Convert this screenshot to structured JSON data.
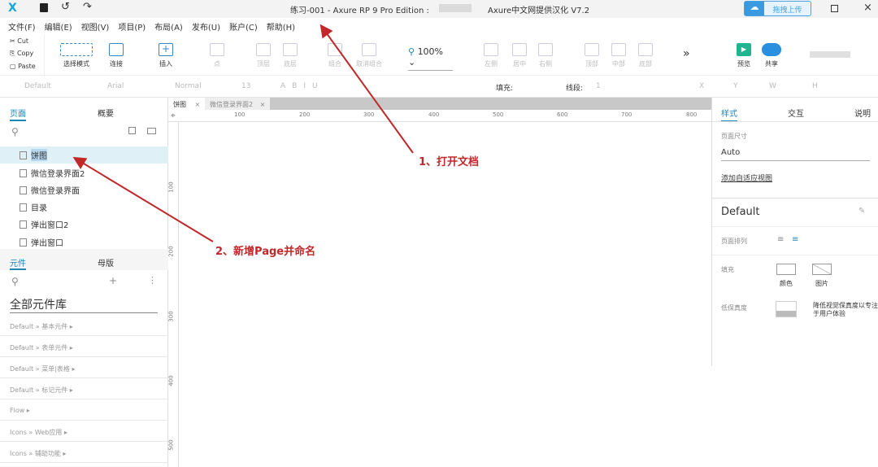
{
  "titlebar": {
    "title": "练习-001 - Axure RP 9 Pro Edition :",
    "subtitle": "Axure中文网提供汉化 V7.2",
    "upload": "拖拽上传"
  },
  "menu": [
    "文件(F)",
    "编辑(E)",
    "视图(V)",
    "项目(P)",
    "布局(A)",
    "发布(U)",
    "账户(C)",
    "帮助(H)"
  ],
  "clipboard": {
    "cut": "Cut",
    "copy": "Copy",
    "paste": "Paste"
  },
  "toolbar": {
    "select_mode": "选择模式",
    "connect": "连接",
    "insert": "插入",
    "point": "点",
    "top_layer": "顶层",
    "bottom_layer": "底层",
    "group": "组合",
    "ungroup": "取消组合",
    "zoom": "100%",
    "left": "左侧",
    "center": "居中",
    "right": "右侧",
    "top": "顶部",
    "middle": "中部",
    "bottom": "底部",
    "more": "»",
    "preview": "预览",
    "share": "共享"
  },
  "format": {
    "style": "Default",
    "font": "Arial",
    "weight": "Normal",
    "size": "13",
    "fill": "填充:",
    "line": "线段:",
    "line_w": "1",
    "x": "X",
    "y": "Y",
    "w": "W",
    "h": "H"
  },
  "doc_tabs": [
    "饼图",
    "微信登录界面2"
  ],
  "ruler": {
    "h": [
      "100",
      "200",
      "300",
      "400",
      "500",
      "600",
      "700",
      "800"
    ],
    "v": [
      "100",
      "200",
      "300",
      "400",
      "500"
    ]
  },
  "left": {
    "tabs": [
      "页面",
      "概要"
    ],
    "pages": [
      "饼图",
      "微信登录界面2",
      "微信登录界面",
      "目录",
      "弹出窗口2",
      "弹出窗口"
    ],
    "lib_tabs": [
      "元件",
      "母版"
    ],
    "library": "全部元件库",
    "categories": [
      "Default » 基本元件 ▸",
      "Default » 表单元件 ▸",
      "Default » 菜单|表格 ▸",
      "Default » 标记元件 ▸",
      "Flow ▸",
      "Icons » Web应用 ▸",
      "Icons » 辅助功能 ▸"
    ]
  },
  "right": {
    "tabs": [
      "样式",
      "交互",
      "说明"
    ],
    "page_size_label": "页面尺寸",
    "page_size": "Auto",
    "adaptive": "添加自适应视图",
    "style_name": "Default",
    "align_label": "页面排列",
    "fill_label": "填充",
    "fill_color": "颜色",
    "fill_image": "图片",
    "low_fi_label": "低保真度",
    "low_fi_desc": "降低视觉保真度以专注于用户体验"
  },
  "annotations": {
    "a1": "1、打开文档",
    "a2": "2、新增Page并命名"
  },
  "colors": {
    "accent": "#1e86b8",
    "annotation": "#c0282a",
    "preview": "#1fb58f",
    "share": "#2b8fe0"
  }
}
